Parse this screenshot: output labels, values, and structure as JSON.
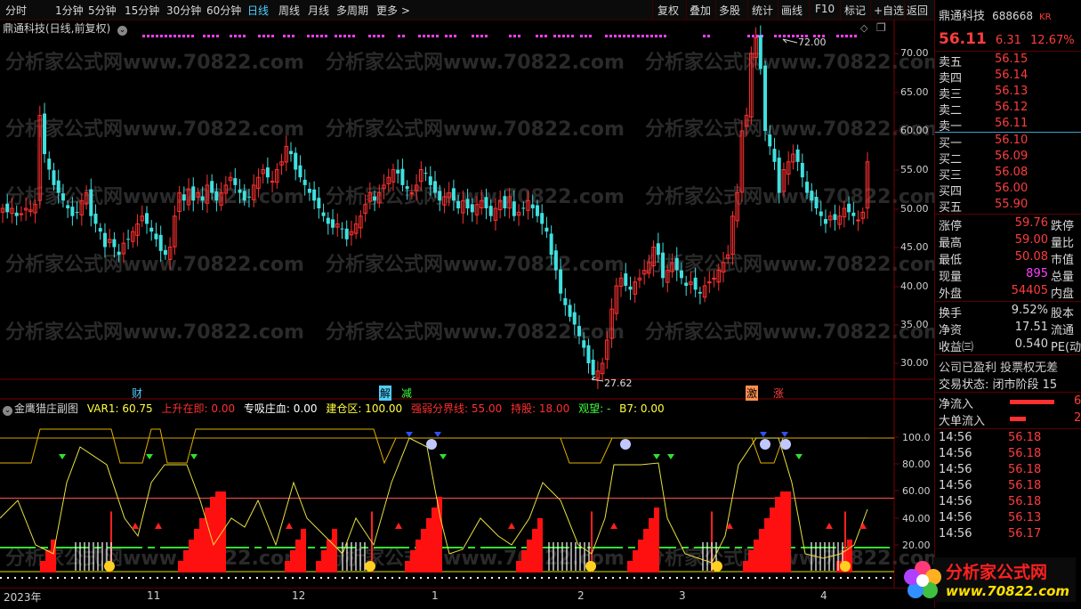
{
  "toolbar": {
    "periods": [
      "分时",
      "1分钟",
      "5分钟",
      "15分钟",
      "30分钟",
      "60分钟",
      "日线",
      "周线",
      "月线",
      "多周期",
      "更多 >"
    ],
    "active": "日线",
    "right": [
      "复权",
      "叠加",
      "多股",
      "统计",
      "画线",
      "F10",
      "标记",
      "+自选",
      "返回"
    ]
  },
  "chart": {
    "title": "鼎通科技(日线,前复权)",
    "watermark": "分析家公式网www.70822.com",
    "yticks": [
      "70.00",
      "65.00",
      "60.00",
      "55.00",
      "50.00",
      "45.00",
      "40.00",
      "35.00",
      "30.00"
    ],
    "high_label": "72.00",
    "low_label": "27.62",
    "markers": [
      {
        "text": "财",
        "color": "#4fd0ff"
      },
      {
        "text": "解",
        "color": "#4fd0ff"
      },
      {
        "text": "减",
        "color": "#40ff40"
      },
      {
        "text": "激",
        "color": "#ff8040"
      },
      {
        "text": "涨",
        "color": "#ff4040"
      }
    ]
  },
  "indicator": {
    "name": "金鹰猎庄副图",
    "var1": "VAR1: 60.75",
    "up": "上升在即: 0.00",
    "zhuan": "专吸庄血: 0.00",
    "jian": "建仓区: 100.00",
    "qiang": "强弱分界线: 55.00",
    "chi": "持股: 18.00",
    "guan": "观望: -",
    "b7": "B7: 0.00",
    "yticks": [
      "100.0",
      "80.00",
      "60.00",
      "40.00",
      "20.00"
    ]
  },
  "xaxis": [
    "2023年",
    "11",
    "12",
    "1",
    "2",
    "3",
    "4"
  ],
  "stock": {
    "name": "鼎通科技",
    "code": "688668",
    "suffix": "KR",
    "price": "56.11",
    "change": "6.31",
    "pct": "12.67%"
  },
  "asks": [
    {
      "label": "卖五",
      "price": "56.15"
    },
    {
      "label": "卖四",
      "price": "56.14"
    },
    {
      "label": "卖三",
      "price": "56.13"
    },
    {
      "label": "卖二",
      "price": "56.12"
    },
    {
      "label": "卖一",
      "price": "56.11"
    }
  ],
  "bids": [
    {
      "label": "买一",
      "price": "56.10"
    },
    {
      "label": "买二",
      "price": "56.09"
    },
    {
      "label": "买三",
      "price": "56.08"
    },
    {
      "label": "买四",
      "price": "56.00"
    },
    {
      "label": "买五",
      "price": "55.90"
    }
  ],
  "stats": [
    {
      "label": "涨停",
      "value": "59.76",
      "label2": "跌停"
    },
    {
      "label": "最高",
      "value": "59.00",
      "label2": "量比"
    },
    {
      "label": "最低",
      "value": "50.08",
      "label2": "市值"
    },
    {
      "label": "现量",
      "value": "895",
      "label2": "总量"
    },
    {
      "label": "外盘",
      "value": "54405",
      "label2": "内盘"
    }
  ],
  "stats2": [
    {
      "label": "换手",
      "value": "9.52%",
      "label2": "股本"
    },
    {
      "label": "净资",
      "value": "17.51",
      "label2": "流通"
    },
    {
      "label": "收益㈢",
      "value": "0.540",
      "label2": "PE(动"
    }
  ],
  "company": {
    "line1": "公司已盈利 投票权无差",
    "line2": "交易状态: 闭市阶段 15"
  },
  "flows": [
    {
      "label": "净流入",
      "value": "6"
    },
    {
      "label": "大单流入",
      "value": "2"
    }
  ],
  "ticks": [
    {
      "time": "14:56",
      "price": "56.18"
    },
    {
      "time": "14:56",
      "price": "56.18"
    },
    {
      "time": "14:56",
      "price": "56.18"
    },
    {
      "time": "14:56",
      "price": "56.18"
    },
    {
      "time": "14:56",
      "price": "56.18"
    },
    {
      "time": "14:56",
      "price": "56.13"
    },
    {
      "time": "14:56",
      "price": "56.17"
    }
  ],
  "logo": {
    "line1": "分析家公式网",
    "line2": "www.70822.com"
  }
}
